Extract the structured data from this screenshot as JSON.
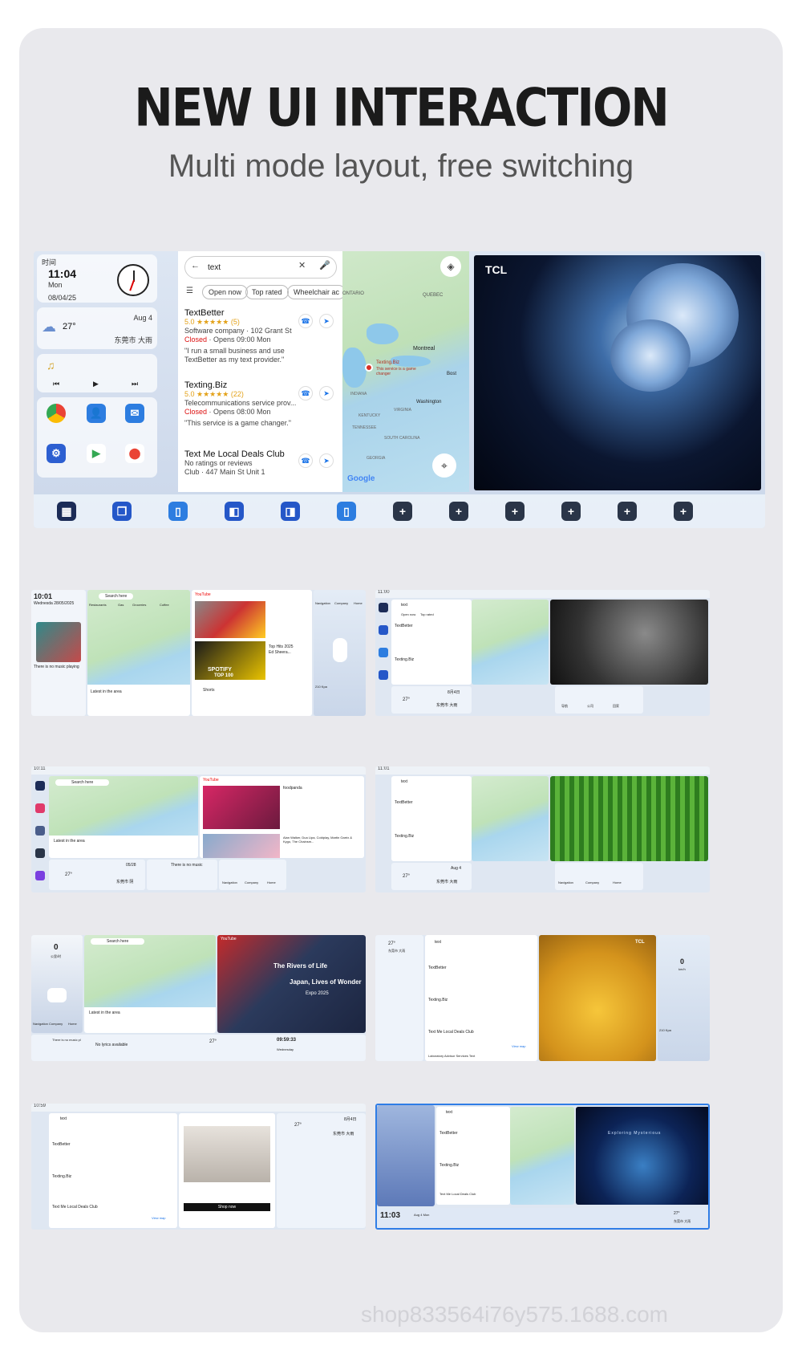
{
  "header": {
    "title": "NEW UI INTERACTION",
    "subtitle": "Multi mode layout, free switching"
  },
  "main": {
    "widgets": {
      "clock_label": "时间",
      "time": "11:04",
      "weekday": "Mon",
      "date": "08/04/25",
      "weather_temp": "27°",
      "weather_date": "Aug 4",
      "weather_location": "东莞市 大雨"
    },
    "search": {
      "query": "text",
      "chips": [
        "Open now",
        "Top rated",
        "Wheelchair ac"
      ],
      "results": [
        {
          "name": "TextBetter",
          "rating": "5.0 ★★★★★ (5)",
          "type": "Software company · 102 Grant St",
          "status": "Closed",
          "hours": " · Opens 09:00 Mon",
          "review": "\"I run a small business and use TextBetter as my text provider.\""
        },
        {
          "name": "Texting.Biz",
          "rating": "5.0 ★★★★★ (22)",
          "type": "Telecommunications service prov...",
          "status": "Closed",
          "hours": " · Opens 08:00 Mon",
          "review": "\"This service is a game changer.\""
        },
        {
          "name": "Text Me Local Deals Club",
          "rating": "No ratings or reviews",
          "type": "Club · 447 Main St Unit 1",
          "status": "",
          "hours": "",
          "review": ""
        }
      ]
    },
    "map": {
      "labels": [
        "ONTARIO",
        "QUEBEC",
        "Montreal",
        "Texting.Biz",
        "This service is a game changer",
        "Washington",
        "Bost",
        "KENTUCKY",
        "VIRGINIA",
        "TENNESSEE",
        "SOUTH CAROLINA",
        "GEORGIA",
        "INDIANA"
      ],
      "logo": "Google"
    },
    "video": {
      "brand": "TCL"
    }
  },
  "thumbnails": [
    {
      "time": "10:01",
      "sub": "Wednesda 28/05/2025",
      "labels": [
        "Search here",
        "Restaurants",
        "Gas",
        "Groceries",
        "Coffee",
        "YouTube",
        "Top Hits 2025",
        "Ed Sheera...",
        "SPOTIFY",
        "TOP 100",
        "Shorts",
        "There is no music playing",
        "Latest in the area",
        "Navigation",
        "Company",
        "Home",
        "210 Kpa"
      ]
    },
    {
      "time": "11:00",
      "sub": "",
      "labels": [
        "text",
        "Open now",
        "Top rated",
        "TextBetter",
        "Texting.Biz",
        "8月4日",
        "27°",
        "东莞市 大雨",
        "导航",
        "公司",
        "回家"
      ]
    },
    {
      "time": "10:11",
      "sub": "",
      "labels": [
        "Search here",
        "Latest in the area",
        "foodpanda",
        "Alan Walker, Dua Lipa, Coldplay, Martin Garrix & Kygo, The Chainsm...",
        "05/28",
        "27°",
        "东莞市 阴",
        "There is no music",
        "Navigation",
        "Company",
        "Home",
        "YouTube"
      ]
    },
    {
      "time": "11:01",
      "sub": "",
      "labels": [
        "text",
        "TextBetter",
        "Texting.Biz",
        "Aug 4",
        "27°",
        "东莞市 大雨",
        "Navigation",
        "Company",
        "Home"
      ]
    },
    {
      "time": "0",
      "sub": "公里/时",
      "labels": [
        "Search here",
        "Latest in the area",
        "YouTube",
        "The Rivers of Life",
        "Japan, Lives of Wonder",
        "Expo 2025",
        "There is no music pl",
        "No lyrics available",
        "27°",
        "09:59:33",
        "Wednesday",
        "Navigation",
        "Company",
        "Home"
      ]
    },
    {
      "time": "27°",
      "sub": "东莞市 大雨",
      "labels": [
        "text",
        "TextBetter",
        "Texting.Biz",
        "Text Me Local Deals Club",
        "Laboratory Advisor Services Text",
        "View map",
        "TCL",
        "0",
        "km/h",
        "210 Kpa"
      ]
    },
    {
      "time": "10:59",
      "sub": "",
      "labels": [
        "text",
        "TextBetter",
        "Texting.Biz",
        "Text Me Local Deals Club",
        "View map",
        "27°",
        "8月4日",
        "东莞市 大雨",
        "Shop now"
      ]
    },
    {
      "time": "11:03",
      "sub": "Aug 4 Mon",
      "labels": [
        "text",
        "TextBetter",
        "Texting.Biz",
        "Text Me Local Deals Club",
        "Exploring Mysterious",
        "27°",
        "东莞市 大雨"
      ]
    }
  ],
  "watermark": "shop833564i76y575.1688.com",
  "colors": {
    "accent": "#1a73e8",
    "closed": "#d11111",
    "background": "#e9e9ed"
  }
}
